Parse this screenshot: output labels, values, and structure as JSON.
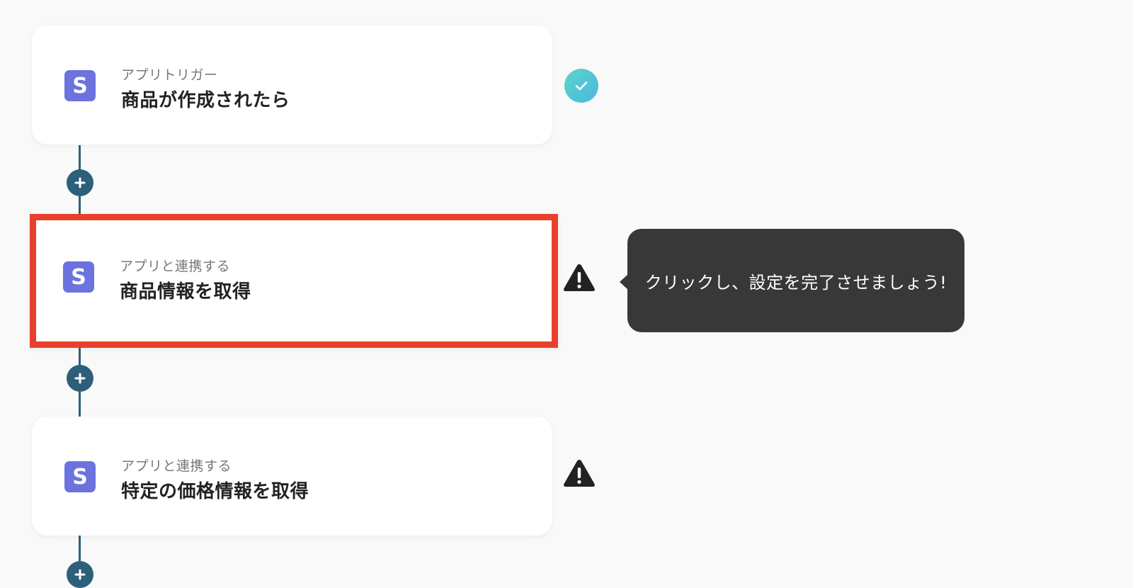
{
  "flow": {
    "steps": [
      {
        "subtitle": "アプリトリガー",
        "title": "商品が作成されたら",
        "app_icon_letter": "S",
        "status": "complete",
        "status_icon": "check-icon"
      },
      {
        "subtitle": "アプリと連携する",
        "title": "商品情報を取得",
        "app_icon_letter": "S",
        "status": "warning",
        "status_icon": "warning-icon",
        "highlighted": true
      },
      {
        "subtitle": "アプリと連携する",
        "title": "特定の価格情報を取得",
        "app_icon_letter": "S",
        "status": "warning",
        "status_icon": "warning-icon"
      }
    ],
    "add_step_icon": "plus-icon"
  },
  "tooltip": {
    "text": "クリックし、設定を完了させましょう!"
  },
  "colors": {
    "background": "#f9f9f9",
    "connector": "#2d5f7a",
    "app_icon": "#6c72de",
    "highlight_border": "#e8402a",
    "tooltip_bg": "#383838",
    "check_start": "#5ad6c6",
    "check_end": "#4ab7e2",
    "warning": "#222222"
  }
}
